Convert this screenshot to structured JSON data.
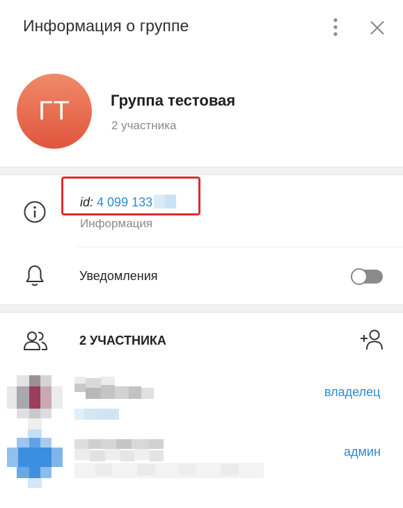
{
  "header": {
    "title": "Информация о группе",
    "more_icon": "more-vertical-icon",
    "close_icon": "close-icon"
  },
  "group": {
    "avatar_initials": "ГТ",
    "avatar_colors": [
      "#f08a68",
      "#e0553e"
    ],
    "name": "Группа тестовая",
    "members_count_text": "2 участника"
  },
  "info": {
    "id_label": "id:",
    "id_value": "4 099 133",
    "caption": "Информация",
    "icon": "info-icon",
    "highlight_color": "#e02b2b"
  },
  "notifications": {
    "label": "Уведомления",
    "enabled": false,
    "icon": "bell-icon"
  },
  "members": {
    "title": "2 УЧАСТНИКА",
    "icon": "people-icon",
    "add_icon": "add-member-icon",
    "list": [
      {
        "role": "владелец"
      },
      {
        "role": "админ"
      }
    ]
  },
  "colors": {
    "accent": "#2b8bd0",
    "muted": "#8a8a8a"
  }
}
